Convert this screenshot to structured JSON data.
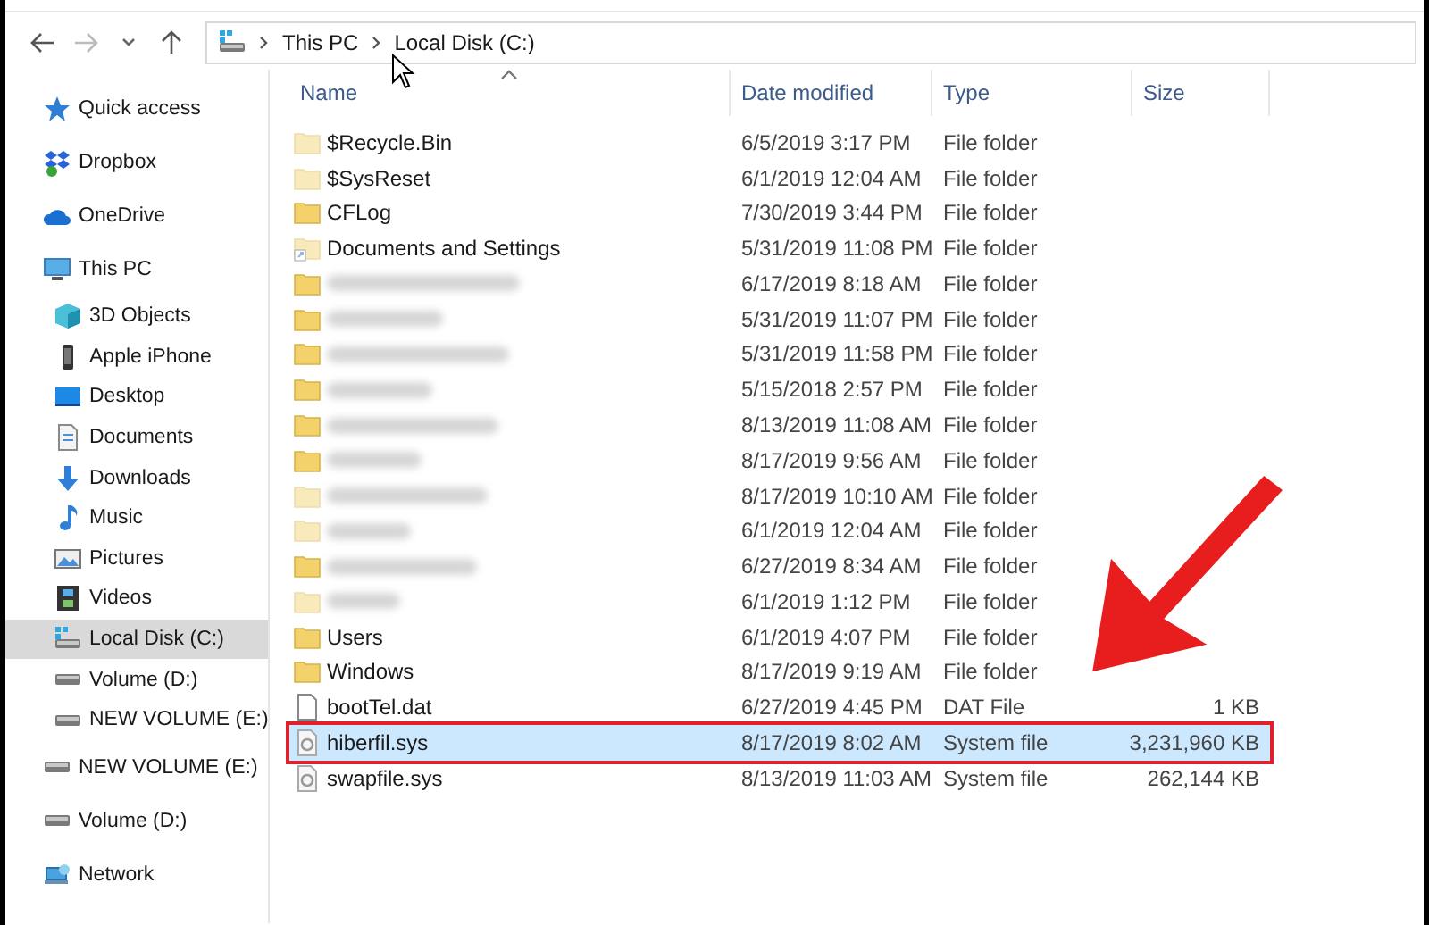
{
  "address_bar": {
    "path": [
      {
        "label": "This PC"
      },
      {
        "label": "Local Disk (C:)"
      }
    ]
  },
  "sidebar": {
    "items": [
      {
        "label": "Quick access",
        "kind": "star",
        "selected": false
      },
      {
        "label": "Dropbox",
        "kind": "dropbox",
        "selected": false
      },
      {
        "label": "OneDrive",
        "kind": "cloud",
        "selected": false
      },
      {
        "label": "This PC",
        "kind": "pc",
        "selected": false,
        "children": [
          {
            "label": "3D Objects",
            "kind": "cube",
            "selected": false
          },
          {
            "label": "Apple iPhone",
            "kind": "phone",
            "selected": false
          },
          {
            "label": "Desktop",
            "kind": "desktop",
            "selected": false
          },
          {
            "label": "Documents",
            "kind": "document",
            "selected": false
          },
          {
            "label": "Downloads",
            "kind": "download",
            "selected": false
          },
          {
            "label": "Music",
            "kind": "music",
            "selected": false
          },
          {
            "label": "Pictures",
            "kind": "picture",
            "selected": false
          },
          {
            "label": "Videos",
            "kind": "video",
            "selected": false
          },
          {
            "label": "Local Disk (C:)",
            "kind": "sysdrive",
            "selected": true
          },
          {
            "label": "Volume (D:)",
            "kind": "drive",
            "selected": false
          },
          {
            "label": "NEW VOLUME (E:)",
            "kind": "drive",
            "selected": false
          }
        ]
      },
      {
        "label": "NEW VOLUME (E:)",
        "kind": "drive",
        "selected": false
      },
      {
        "label": "Volume (D:)",
        "kind": "drive",
        "selected": false
      },
      {
        "label": "Network",
        "kind": "network",
        "selected": false
      }
    ]
  },
  "table": {
    "columns": [
      {
        "label": "Name",
        "sorted": true
      },
      {
        "label": "Date modified",
        "sorted": false
      },
      {
        "label": "Type",
        "sorted": false
      },
      {
        "label": "Size",
        "sorted": false
      }
    ],
    "rows": [
      {
        "name": "$Recycle.Bin",
        "kind": "folder",
        "hidden": true,
        "blurred": false,
        "date": "6/5/2019 3:17 PM",
        "type": "File folder",
        "selected": false,
        "annotated": false
      },
      {
        "name": "$SysReset",
        "kind": "folder",
        "hidden": true,
        "blurred": false,
        "date": "6/1/2019 12:04 AM",
        "type": "File folder",
        "selected": false,
        "annotated": false
      },
      {
        "name": "CFLog",
        "kind": "folder",
        "hidden": false,
        "blurred": false,
        "date": "7/30/2019 3:44 PM",
        "type": "File folder",
        "selected": false,
        "annotated": false
      },
      {
        "name": "Documents and Settings",
        "kind": "shortcut",
        "hidden": true,
        "blurred": false,
        "date": "5/31/2019 11:08 PM",
        "type": "File folder",
        "selected": false,
        "annotated": false
      },
      {
        "kind": "folder",
        "hidden": false,
        "blurred": true,
        "date": "6/17/2019 8:18 AM",
        "type": "File folder",
        "selected": false,
        "annotated": false
      },
      {
        "kind": "folder",
        "hidden": false,
        "blurred": true,
        "date": "5/31/2019 11:07 PM",
        "type": "File folder",
        "selected": false,
        "annotated": false
      },
      {
        "kind": "folder",
        "hidden": false,
        "blurred": true,
        "date": "5/31/2019 11:58 PM",
        "type": "File folder",
        "selected": false,
        "annotated": false
      },
      {
        "kind": "folder",
        "hidden": false,
        "blurred": true,
        "date": "5/15/2018 2:57 PM",
        "type": "File folder",
        "selected": false,
        "annotated": false
      },
      {
        "kind": "folder",
        "hidden": false,
        "blurred": true,
        "date": "8/13/2019 11:08 AM",
        "type": "File folder",
        "selected": false,
        "annotated": false
      },
      {
        "kind": "folder",
        "hidden": false,
        "blurred": true,
        "date": "8/17/2019 9:56 AM",
        "type": "File folder",
        "selected": false,
        "annotated": false
      },
      {
        "kind": "folder",
        "hidden": true,
        "blurred": true,
        "date": "8/17/2019 10:10 AM",
        "type": "File folder",
        "selected": false,
        "annotated": false
      },
      {
        "kind": "folder",
        "hidden": true,
        "blurred": true,
        "date": "6/1/2019 12:04 AM",
        "type": "File folder",
        "selected": false,
        "annotated": false
      },
      {
        "kind": "folder",
        "hidden": false,
        "blurred": true,
        "date": "6/27/2019 8:34 AM",
        "type": "File folder",
        "selected": false,
        "annotated": false
      },
      {
        "kind": "folder",
        "hidden": true,
        "blurred": true,
        "date": "6/1/2019 1:12 PM",
        "type": "File folder",
        "selected": false,
        "annotated": false
      },
      {
        "name": "Users",
        "kind": "folder",
        "hidden": false,
        "blurred": false,
        "date": "6/1/2019 4:07 PM",
        "type": "File folder",
        "selected": false,
        "annotated": false
      },
      {
        "name": "Windows",
        "kind": "folder",
        "hidden": false,
        "blurred": false,
        "date": "8/17/2019 9:19 AM",
        "type": "File folder",
        "selected": false,
        "annotated": false
      },
      {
        "name": "bootTel.dat",
        "kind": "file",
        "hidden": false,
        "blurred": false,
        "date": "6/27/2019 4:45 PM",
        "type": "DAT File",
        "size": "1 KB",
        "selected": false,
        "annotated": false
      },
      {
        "name": "hiberfil.sys",
        "kind": "sysfile",
        "hidden": false,
        "blurred": false,
        "date": "8/17/2019 8:02 AM",
        "type": "System file",
        "size": "3,231,960 KB",
        "selected": true,
        "annotated": true
      },
      {
        "name": "swapfile.sys",
        "kind": "sysfile",
        "hidden": false,
        "blurred": false,
        "date": "8/13/2019 11:03 AM",
        "type": "System file",
        "size": "262,144 KB",
        "selected": false,
        "annotated": false
      }
    ]
  }
}
